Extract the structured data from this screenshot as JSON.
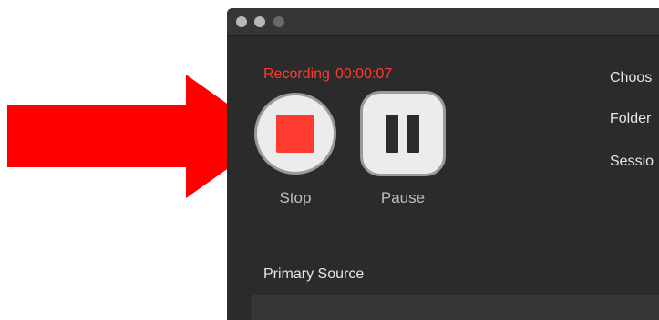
{
  "status": {
    "recording_label": "Recording",
    "elapsed": "00:00:07"
  },
  "controls": {
    "stop_label": "Stop",
    "pause_label": "Pause"
  },
  "right_panel": {
    "choose_label": "Choos",
    "folder_label": "Folder",
    "session_label": "Sessio"
  },
  "source": {
    "primary_label": "Primary Source"
  },
  "colors": {
    "arrow": "#ff0000",
    "recording_text": "#ff3b30",
    "window_bg": "#2b2b2b"
  }
}
